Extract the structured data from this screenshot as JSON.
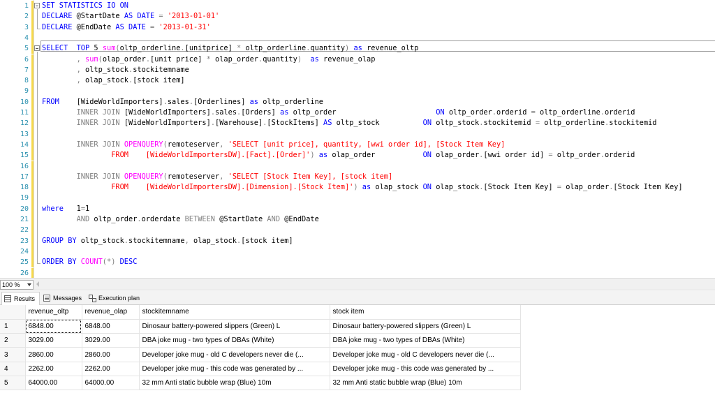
{
  "editor": {
    "line_numbers": [
      "1",
      "2",
      "3",
      "4",
      "5",
      "6",
      "7",
      "8",
      "9",
      "10",
      "11",
      "12",
      "13",
      "14",
      "15",
      "16",
      "17",
      "18",
      "19",
      "20",
      "21",
      "22",
      "23",
      "24",
      "25",
      "26"
    ],
    "colors": {
      "keyword": "#0000ff",
      "string": "#ff0000",
      "function": "#ff00ff",
      "operator": "#808080",
      "line_number": "#2b91af",
      "changed_marker": "#f7d94a"
    },
    "lines": [
      [
        [
          "kw",
          "SET STATISTICS IO ON"
        ]
      ],
      [
        [
          "kw",
          "DECLARE "
        ],
        [
          "id",
          "@StartDate "
        ],
        [
          "kw",
          "AS DATE "
        ],
        [
          "op",
          "= "
        ],
        [
          "str",
          "'2013-01-01'"
        ]
      ],
      [
        [
          "kw",
          "DECLARE "
        ],
        [
          "id",
          "@EndDate "
        ],
        [
          "kw",
          "AS DATE "
        ],
        [
          "op",
          "= "
        ],
        [
          "str",
          "'2013-01-31'"
        ]
      ],
      [],
      [
        [
          "kw",
          "SELECT  TOP "
        ],
        [
          "id",
          "5 "
        ],
        [
          "fn",
          "sum"
        ],
        [
          "op",
          "("
        ],
        [
          "id",
          "oltp_orderline"
        ],
        [
          "op",
          "."
        ],
        [
          "id",
          "[unitprice] "
        ],
        [
          "op",
          "* "
        ],
        [
          "id",
          "oltp_orderline"
        ],
        [
          "op",
          "."
        ],
        [
          "id",
          "quantity"
        ],
        [
          "op",
          ") "
        ],
        [
          "kw",
          "as "
        ],
        [
          "id",
          "revenue_oltp"
        ]
      ],
      [
        [
          "op",
          "        , "
        ],
        [
          "fn",
          "sum"
        ],
        [
          "op",
          "("
        ],
        [
          "id",
          "olap_order"
        ],
        [
          "op",
          "."
        ],
        [
          "id",
          "[unit price] "
        ],
        [
          "op",
          "* "
        ],
        [
          "id",
          "olap_order"
        ],
        [
          "op",
          "."
        ],
        [
          "id",
          "quantity"
        ],
        [
          "op",
          ")  "
        ],
        [
          "kw",
          "as "
        ],
        [
          "id",
          "revenue_olap"
        ]
      ],
      [
        [
          "op",
          "        , "
        ],
        [
          "id",
          "oltp_stock"
        ],
        [
          "op",
          "."
        ],
        [
          "id",
          "stockitemname"
        ]
      ],
      [
        [
          "op",
          "        , "
        ],
        [
          "id",
          "olap_stock"
        ],
        [
          "op",
          "."
        ],
        [
          "id",
          "[stock item]"
        ]
      ],
      [],
      [
        [
          "kw",
          "FROM    "
        ],
        [
          "id",
          "[WideWorldImporters]"
        ],
        [
          "op",
          "."
        ],
        [
          "id",
          "sales"
        ],
        [
          "op",
          "."
        ],
        [
          "id",
          "[Orderlines] "
        ],
        [
          "kw",
          "as "
        ],
        [
          "id",
          "oltp_orderline"
        ]
      ],
      [
        [
          "op",
          "        "
        ],
        [
          "op",
          "INNER JOIN "
        ],
        [
          "id",
          "[WideWorldImporters]"
        ],
        [
          "op",
          "."
        ],
        [
          "id",
          "sales"
        ],
        [
          "op",
          "."
        ],
        [
          "id",
          "[Orders] "
        ],
        [
          "kw",
          "as "
        ],
        [
          "id",
          "oltp_order                       "
        ],
        [
          "kw",
          "ON "
        ],
        [
          "id",
          "oltp_order"
        ],
        [
          "op",
          "."
        ],
        [
          "id",
          "orderid "
        ],
        [
          "op",
          "= "
        ],
        [
          "id",
          "oltp_orderline"
        ],
        [
          "op",
          "."
        ],
        [
          "id",
          "orderid"
        ]
      ],
      [
        [
          "op",
          "        "
        ],
        [
          "op",
          "INNER JOIN "
        ],
        [
          "id",
          "[WideWorldImporters]"
        ],
        [
          "op",
          "."
        ],
        [
          "id",
          "[Warehouse]"
        ],
        [
          "op",
          "."
        ],
        [
          "id",
          "[StockItems] "
        ],
        [
          "kw",
          "AS "
        ],
        [
          "id",
          "oltp_stock          "
        ],
        [
          "kw",
          "ON "
        ],
        [
          "id",
          "oltp_stock"
        ],
        [
          "op",
          "."
        ],
        [
          "id",
          "stockitemid "
        ],
        [
          "op",
          "= "
        ],
        [
          "id",
          "oltp_orderline"
        ],
        [
          "op",
          "."
        ],
        [
          "id",
          "stockitemid"
        ]
      ],
      [],
      [
        [
          "op",
          "        "
        ],
        [
          "op",
          "INNER JOIN "
        ],
        [
          "fn",
          "OPENQUERY"
        ],
        [
          "op",
          "("
        ],
        [
          "id",
          "remoteserver"
        ],
        [
          "op",
          ", "
        ],
        [
          "str",
          "'SELECT [unit price], quantity, [wwi order id], [Stock Item Key]"
        ]
      ],
      [
        [
          "str",
          "                FROM    [WideWorldImportersDW].[Fact].[Order]'"
        ],
        [
          "op",
          ") "
        ],
        [
          "kw",
          "as "
        ],
        [
          "id",
          "olap_order           "
        ],
        [
          "kw",
          "ON "
        ],
        [
          "id",
          "olap_order"
        ],
        [
          "op",
          "."
        ],
        [
          "id",
          "[wwi order id] "
        ],
        [
          "op",
          "= "
        ],
        [
          "id",
          "oltp_order"
        ],
        [
          "op",
          "."
        ],
        [
          "id",
          "orderid"
        ]
      ],
      [],
      [
        [
          "op",
          "        "
        ],
        [
          "op",
          "INNER JOIN "
        ],
        [
          "fn",
          "OPENQUERY"
        ],
        [
          "op",
          "("
        ],
        [
          "id",
          "remoteserver"
        ],
        [
          "op",
          ", "
        ],
        [
          "str",
          "'SELECT [Stock Item Key], [stock item]"
        ]
      ],
      [
        [
          "str",
          "                FROM    [WideWorldImportersDW].[Dimension].[Stock Item]'"
        ],
        [
          "op",
          ") "
        ],
        [
          "kw",
          "as "
        ],
        [
          "id",
          "olap_stock "
        ],
        [
          "kw",
          "ON "
        ],
        [
          "id",
          "olap_stock"
        ],
        [
          "op",
          "."
        ],
        [
          "id",
          "[Stock Item Key] "
        ],
        [
          "op",
          "= "
        ],
        [
          "id",
          "olap_order"
        ],
        [
          "op",
          "."
        ],
        [
          "id",
          "[Stock Item Key]"
        ]
      ],
      [],
      [
        [
          "kw",
          "where   "
        ],
        [
          "id",
          "1"
        ],
        [
          "op",
          "="
        ],
        [
          "id",
          "1"
        ]
      ],
      [
        [
          "op",
          "        AND "
        ],
        [
          "id",
          "oltp_order"
        ],
        [
          "op",
          "."
        ],
        [
          "id",
          "orderdate "
        ],
        [
          "op",
          "BETWEEN "
        ],
        [
          "id",
          "@StartDate "
        ],
        [
          "op",
          "AND "
        ],
        [
          "id",
          "@EndDate"
        ]
      ],
      [],
      [
        [
          "kw",
          "GROUP BY "
        ],
        [
          "id",
          "oltp_stock"
        ],
        [
          "op",
          "."
        ],
        [
          "id",
          "stockitemname"
        ],
        [
          "op",
          ", "
        ],
        [
          "id",
          "olap_stock"
        ],
        [
          "op",
          "."
        ],
        [
          "id",
          "[stock item]"
        ]
      ],
      [],
      [
        [
          "kw",
          "ORDER BY "
        ],
        [
          "fn",
          "COUNT"
        ],
        [
          "op",
          "(*) "
        ],
        [
          "kw",
          "DESC"
        ]
      ],
      []
    ]
  },
  "zoom": {
    "value": "100 %"
  },
  "tabs": [
    {
      "label": "Results",
      "icon": "results-grid-icon",
      "active": true
    },
    {
      "label": "Messages",
      "icon": "messages-icon",
      "active": false
    },
    {
      "label": "Execution plan",
      "icon": "execution-plan-icon",
      "active": false
    }
  ],
  "results": {
    "columns": [
      "revenue_oltp",
      "revenue_olap",
      "stockitemname",
      "stock item"
    ],
    "rows": [
      {
        "n": "1",
        "cells": [
          "6848.00",
          "6848.00",
          "Dinosaur battery-powered slippers (Green) L",
          "Dinosaur battery-powered slippers (Green) L"
        ]
      },
      {
        "n": "2",
        "cells": [
          "3029.00",
          "3029.00",
          "DBA joke mug - two types of DBAs (White)",
          "DBA joke mug - two types of DBAs (White)"
        ]
      },
      {
        "n": "3",
        "cells": [
          "2860.00",
          "2860.00",
          "Developer joke mug - old C developers never die (...",
          "Developer joke mug - old C developers never die (..."
        ]
      },
      {
        "n": "4",
        "cells": [
          "2262.00",
          "2262.00",
          "Developer joke mug - this code was generated by ...",
          "Developer joke mug - this code was generated by ..."
        ]
      },
      {
        "n": "5",
        "cells": [
          "64000.00",
          "64000.00",
          "32 mm Anti static bubble wrap (Blue) 10m",
          "32 mm Anti static bubble wrap (Blue) 10m"
        ]
      }
    ]
  }
}
